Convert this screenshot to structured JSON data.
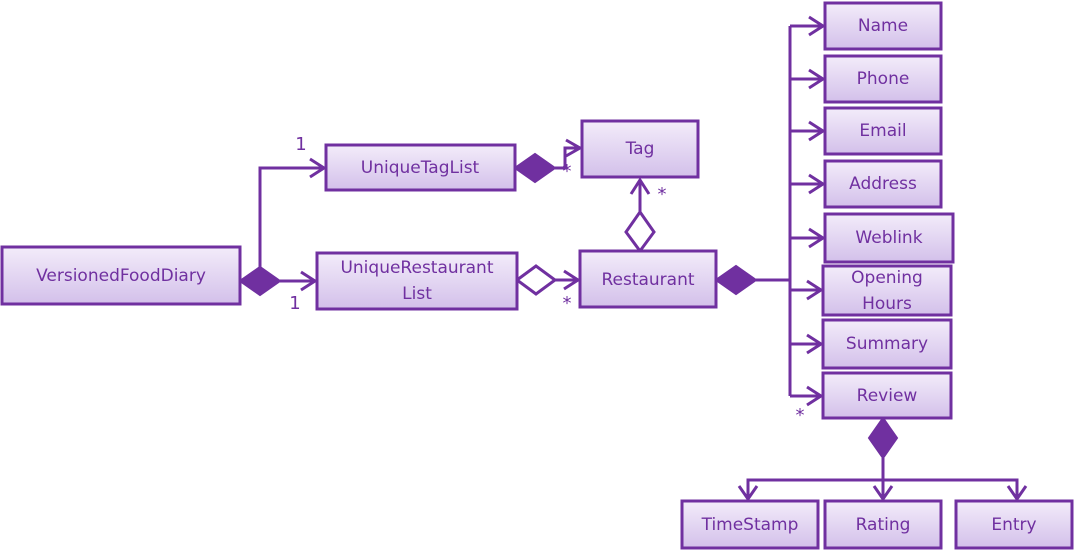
{
  "colors": {
    "accent": "#7030A0",
    "box_top": "#F3ECFA",
    "box_bottom": "#D3C0EA"
  },
  "classes": {
    "versioned_food_diary": "VersionedFoodDiary",
    "unique_tag_list": "UniqueTagList",
    "unique_restaurant_list": [
      "UniqueRestaurant",
      "List"
    ],
    "tag": "Tag",
    "restaurant": "Restaurant",
    "name": "Name",
    "phone": "Phone",
    "email": "Email",
    "address": "Address",
    "weblink": "Weblink",
    "opening_hours": [
      "Opening",
      "Hours"
    ],
    "summary": "Summary",
    "review": "Review",
    "timestamp": "TimeStamp",
    "rating": "Rating",
    "entry": "Entry"
  },
  "multiplicities": {
    "vfd_to_taglist": "1",
    "vfd_to_restaurantlist": "1",
    "taglist_to_tag": "*",
    "restaurant_to_tag": "*",
    "restaurantlist_to_restaurant": "*",
    "restaurant_to_review": "*"
  }
}
